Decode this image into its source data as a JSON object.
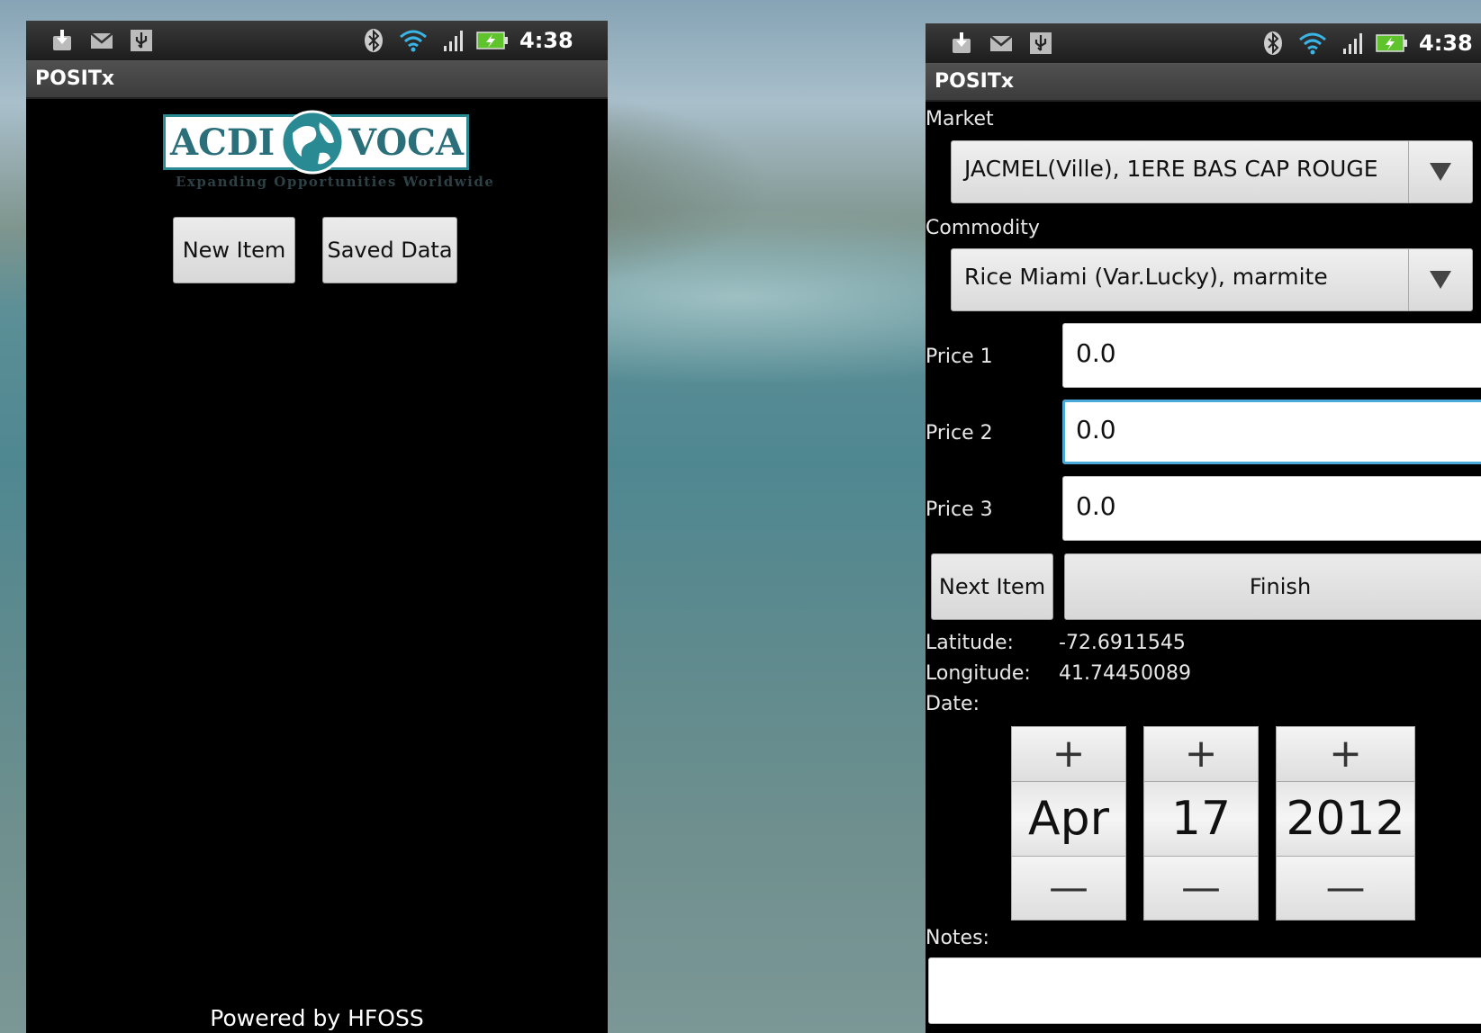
{
  "left_screen": {
    "status": {
      "time": "4:38"
    },
    "app_title": "POSITx",
    "logo": {
      "left": "ACDI",
      "right": "VOCA",
      "tagline": "Expanding Opportunities Worldwide"
    },
    "buttons": {
      "new_item": "New Item",
      "saved_data": "Saved Data"
    },
    "footer": "Powered by HFOSS"
  },
  "right_screen": {
    "status": {
      "time": "4:38"
    },
    "app_title": "POSITx",
    "market": {
      "label": "Market",
      "selected": "JACMEL(Ville), 1ERE BAS CAP ROUGE"
    },
    "commodity": {
      "label": "Commodity",
      "selected": "Rice Miami (Var.Lucky), marmite"
    },
    "prices": [
      {
        "label": "Price 1",
        "value": "0.0"
      },
      {
        "label": "Price 2",
        "value": "0.0"
      },
      {
        "label": "Price 3",
        "value": "0.0"
      }
    ],
    "buttons": {
      "next_item": "Next Item",
      "finish": "Finish"
    },
    "location": {
      "latitude_label": "Latitude:",
      "latitude": "-72.6911545",
      "longitude_label": "Longitude:",
      "longitude": "41.74450089"
    },
    "date": {
      "label": "Date:",
      "plus": "+",
      "minus": "—",
      "month": "Apr",
      "day": "17",
      "year": "2012"
    },
    "notes": {
      "label": "Notes:",
      "value": ""
    }
  },
  "colors": {
    "focus": "#4aa9d8",
    "logo_teal": "#2a8a93"
  },
  "icons": [
    "download-icon",
    "gmail-icon",
    "usb-icon",
    "bluetooth-icon",
    "wifi-icon",
    "signal-icon",
    "battery-charging-icon"
  ]
}
